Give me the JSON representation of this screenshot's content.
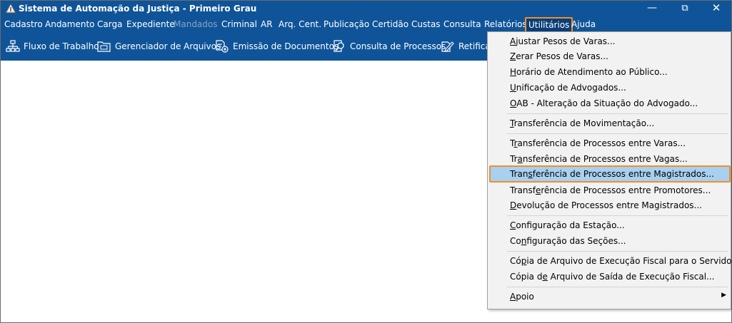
{
  "window": {
    "title": "Sistema de Automação da Justiça - Primeiro Grau",
    "minimize": "—",
    "restore": "⧉",
    "close": "✕"
  },
  "menubar": [
    {
      "label": "Cadastro"
    },
    {
      "label": "Andamento"
    },
    {
      "label": "Carga"
    },
    {
      "label": "Expediente"
    },
    {
      "label": "Mandados",
      "disabled": true
    },
    {
      "label": "Criminal"
    },
    {
      "label": "AR"
    },
    {
      "label": "Arq. Cent."
    },
    {
      "label": "Publicação"
    },
    {
      "label": "Certidão"
    },
    {
      "label": "Custas"
    },
    {
      "label": "Consulta"
    },
    {
      "label": "Relatórios"
    },
    {
      "label": "Utilitários",
      "active": true
    },
    {
      "label": "Ajuda"
    }
  ],
  "toolbar": {
    "fluxo": "Fluxo de Trabalho",
    "gerenciador": "Gerenciador de Arquivos",
    "emissao": "Emissão de Documentos",
    "consulta": "Consulta de Processos",
    "retificar": "Retificar"
  },
  "utilitarios_menu": {
    "items": [
      {
        "pre": "",
        "u": "A",
        "post": "justar Pesos de Varas..."
      },
      {
        "pre": "",
        "u": "Z",
        "post": "erar Pesos de Varas..."
      },
      {
        "pre": "",
        "u": "H",
        "post": "orário de Atendimento ao Público..."
      },
      {
        "pre": "",
        "u": "U",
        "post": "nificação de Advogados..."
      },
      {
        "pre": "",
        "u": "O",
        "post": "AB - Alteração da Situação do Advogado..."
      },
      {
        "pre": "",
        "u": "T",
        "post": "ransferência de Movimentação..."
      },
      {
        "pre": "T",
        "u": "r",
        "post": "ansferência de Processos entre Varas..."
      },
      {
        "pre": "Tr",
        "u": "a",
        "post": "nsferência de Processos entre Vagas..."
      },
      {
        "pre": "Tran",
        "u": "s",
        "post": "ferência de Processos entre Magistrados..."
      },
      {
        "pre": "Transf",
        "u": "e",
        "post": "rência de Processos entre Promotores..."
      },
      {
        "pre": "",
        "u": "D",
        "post": "evolução de Processos entre Magistrados..."
      },
      {
        "pre": "",
        "u": "C",
        "post": "onfiguração da Estação..."
      },
      {
        "pre": "Co",
        "u": "n",
        "post": "figuração das Seções..."
      },
      {
        "pre": "Có",
        "u": "p",
        "post": "ia de Arquivo de Execução Fiscal para o Servidor..."
      },
      {
        "pre": "Cópia d",
        "u": "e",
        "post": " Arquivo de Saída de Execução Fiscal..."
      },
      {
        "pre": "",
        "u": "A",
        "post": "poio"
      }
    ],
    "highlighted_index": 8,
    "submenu_arrow": "▶"
  },
  "colors": {
    "titlebar": "#0f5499",
    "highlight_border": "#f0902a",
    "highlight_fill": "#a8d0f0"
  }
}
